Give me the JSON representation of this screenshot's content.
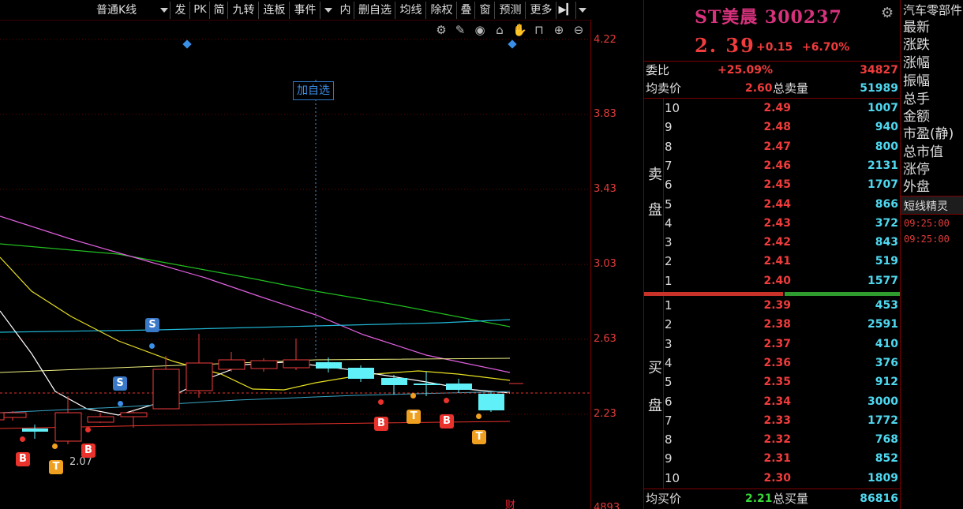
{
  "toolbar": {
    "ktype": "普通K线",
    "buttons": [
      "发",
      "PK",
      "简",
      "九转",
      "连板",
      "事件",
      "内",
      "删自选",
      "均线",
      "除权",
      "叠",
      "窗",
      "预测",
      "更多"
    ]
  },
  "chart": {
    "add_watch_label": "加自选",
    "low_label": "2.07",
    "fin_mark": "财",
    "price_ticks": [
      "4.22",
      "3.83",
      "3.43",
      "3.03",
      "2.63",
      "2.23",
      "4893"
    ],
    "signals": [
      {
        "type": "S",
        "label": "S"
      },
      {
        "type": "S",
        "label": "S"
      },
      {
        "type": "B",
        "label": "B"
      },
      {
        "type": "T",
        "label": "T"
      },
      {
        "type": "B",
        "label": "B"
      },
      {
        "type": "B",
        "label": "B"
      },
      {
        "type": "T",
        "label": "T"
      },
      {
        "type": "B",
        "label": "B"
      },
      {
        "type": "T",
        "label": "T"
      }
    ]
  },
  "quote": {
    "name": "ST美晨 300237",
    "last": "2. 39",
    "change": "+0.15",
    "change_pct": "+6.70%",
    "wei_label": "委比",
    "wei_pct": "+25.09%",
    "wei_diff": "34827",
    "avg_sell_label": "均卖价",
    "avg_sell": "2.60",
    "total_sell_label": "总卖量",
    "total_sell": "51989",
    "sell_side_label": [
      "卖",
      "盘"
    ],
    "buy_side_label": [
      "买",
      "盘"
    ],
    "asks": [
      {
        "lvl": "10",
        "price": "2.49",
        "vol": "1007"
      },
      {
        "lvl": "9",
        "price": "2.48",
        "vol": "940"
      },
      {
        "lvl": "8",
        "price": "2.47",
        "vol": "800"
      },
      {
        "lvl": "7",
        "price": "2.46",
        "vol": "2131"
      },
      {
        "lvl": "6",
        "price": "2.45",
        "vol": "1707"
      },
      {
        "lvl": "5",
        "price": "2.44",
        "vol": "866"
      },
      {
        "lvl": "4",
        "price": "2.43",
        "vol": "372"
      },
      {
        "lvl": "3",
        "price": "2.42",
        "vol": "843"
      },
      {
        "lvl": "2",
        "price": "2.41",
        "vol": "519"
      },
      {
        "lvl": "1",
        "price": "2.40",
        "vol": "1577"
      }
    ],
    "bids": [
      {
        "lvl": "1",
        "price": "2.39",
        "vol": "453"
      },
      {
        "lvl": "2",
        "price": "2.38",
        "vol": "2591"
      },
      {
        "lvl": "3",
        "price": "2.37",
        "vol": "410"
      },
      {
        "lvl": "4",
        "price": "2.36",
        "vol": "376"
      },
      {
        "lvl": "5",
        "price": "2.35",
        "vol": "912"
      },
      {
        "lvl": "6",
        "price": "2.34",
        "vol": "3000"
      },
      {
        "lvl": "7",
        "price": "2.33",
        "vol": "1772"
      },
      {
        "lvl": "8",
        "price": "2.32",
        "vol": "768"
      },
      {
        "lvl": "9",
        "price": "2.31",
        "vol": "852"
      },
      {
        "lvl": "10",
        "price": "2.30",
        "vol": "1809"
      }
    ],
    "avg_buy_label": "均买价",
    "avg_buy": "2.21",
    "total_buy_label": "总买量",
    "total_buy": "86816"
  },
  "info": {
    "industry": "汽车零部件",
    "rows": [
      "最新",
      "涨跌",
      "涨幅",
      "振幅",
      "总手",
      "金额",
      "市盈(静)",
      "总市值",
      "涨停",
      "外盘"
    ],
    "spirit_title": "短线精灵",
    "times": [
      "09:25:00",
      "09:25:00"
    ]
  },
  "colors": {
    "up": "#f03c3c",
    "down_candle": "#5ff0f8",
    "ma5": "#ffffff",
    "ma10": "#e8e020",
    "ma20": "#e060e0",
    "ma60": "#20c020",
    "ma120": "#20b8d8",
    "ma250": "#f0f080"
  }
}
